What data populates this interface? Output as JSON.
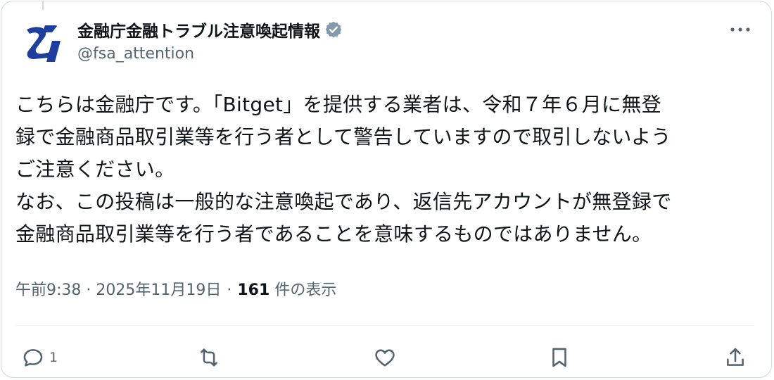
{
  "post": {
    "display_name": "金融庁金融トラブル注意喚起情報",
    "handle": "@fsa_attention",
    "verified_icon": "verified-badge-icon",
    "text": "こちらは金融庁です。「Bitget」を提供する業者は、令和７年６月に無登\n録で金融商品取引業等を行う者として警告していますので取引しないよう\nご注意ください。\nなお、この投稿は一般的な注意喚起であり、返信先アカウントが無登録で\n金融商品取引業等を行う者であることを意味するものではありません。",
    "timestamp": "午前9:38 · 2025年11月19日",
    "separator": "·",
    "view_count": "161",
    "view_label": "件の表示"
  },
  "actions": {
    "reply_count": "1"
  },
  "colors": {
    "text_primary": "#0f1419",
    "text_secondary": "#536471",
    "border": "#cfd9de",
    "verified": "#829aab",
    "logo_blue": "#1f3f9c"
  }
}
